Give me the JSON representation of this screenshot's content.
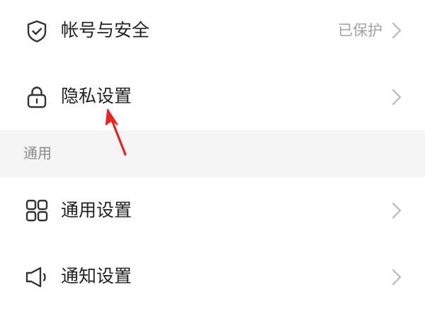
{
  "colors": {
    "background": "#ffffff",
    "section_background": "#f5f5f5",
    "label_text": "#222222",
    "secondary_text": "#a3a3a3",
    "section_text": "#8a8a8a",
    "icon_stroke": "#333333",
    "chevron": "#b8b8b8",
    "annotation_arrow": "#e8251c"
  },
  "settings": {
    "account_security": {
      "icon": "shield-check-icon",
      "label": "帐号与安全",
      "status": "已保护"
    },
    "privacy": {
      "icon": "lock-icon",
      "label": "隐私设置"
    }
  },
  "general_section": {
    "header": "通用",
    "items": [
      {
        "icon": "grid-icon",
        "label": "通用设置"
      },
      {
        "icon": "speaker-icon",
        "label": "通知设置"
      }
    ]
  },
  "annotation": {
    "icon": "red-arrow-icon"
  }
}
